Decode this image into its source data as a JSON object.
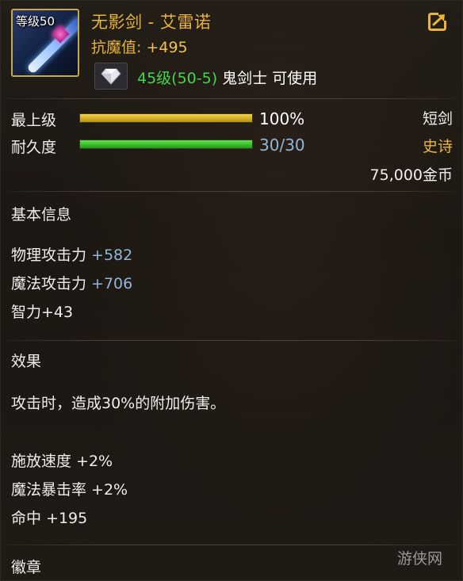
{
  "item": {
    "level_badge": "等级50",
    "name": "无影剑 - 艾雷诺",
    "resist_label": "抗魔值:",
    "resist_value": "+495",
    "requirement_level": "45级(50-5)",
    "requirement_class": "鬼剑士 可使用"
  },
  "bars": {
    "grade_label": "最上级",
    "grade_value": 100,
    "grade_text": "100%",
    "durability_label": "耐久度",
    "durability_value": 1.0,
    "durability_text": "30/30"
  },
  "meta": {
    "weapon_type": "短剑",
    "rarity": "史诗",
    "price": "75,000金币"
  },
  "basic_info": {
    "title": "基本信息",
    "stats": [
      {
        "name": "物理攻击力 ",
        "bonus": "+582"
      },
      {
        "name": "魔法攻击力 ",
        "bonus": "+706"
      },
      {
        "name": "智力+43",
        "bonus": ""
      }
    ]
  },
  "effects": {
    "title": "效果",
    "description": "攻击时，造成30%的附加伤害。",
    "stats": [
      {
        "text": "施放速度 +2%"
      },
      {
        "text": "魔法暴击率 +2%"
      },
      {
        "text": "命中 +195"
      }
    ]
  },
  "emblem": {
    "title": "徽章"
  },
  "watermark": {
    "text": "游侠网"
  },
  "colors": {
    "gold": "#e8b43a",
    "green": "#43d64a",
    "blue_bonus": "#8fb7d8",
    "rarity_epic": "#e8b43a",
    "bar_gold": "#c9a41e",
    "bar_green": "#3ec92a"
  },
  "icons": {
    "weapon": "sword-icon",
    "share": "share-export-icon",
    "gem": "diamond-icon"
  }
}
